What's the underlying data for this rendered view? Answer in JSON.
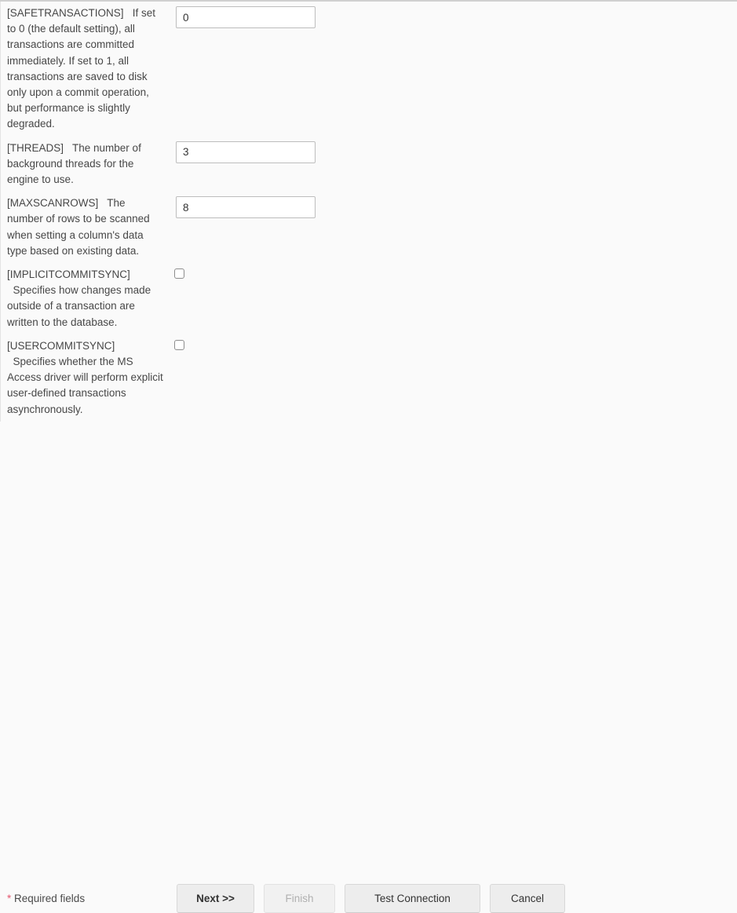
{
  "window": {
    "background_color": "#fafafa",
    "text_color": "#474747"
  },
  "form": {
    "rows": [
      {
        "label": "[SAFETRANSACTIONS]   If set to 0 (the default setting), all transactions are committed immediately. If set to 1, all transactions are saved to disk only upon a commit operation, but performance is slightly degraded.",
        "control": "text",
        "name": "safetransactions",
        "value": "0",
        "placeholder": ""
      },
      {
        "label": "[THREADS]   The number of background threads for the engine to use.",
        "control": "text",
        "name": "threads",
        "value": "3",
        "placeholder": ""
      },
      {
        "label": "[MAXSCANROWS]   The number of rows to be scanned when setting a column's data type based on existing data.",
        "control": "text",
        "name": "maxscanrows",
        "value": "8",
        "placeholder": ""
      },
      {
        "label": "[IMPLICITCOMMITSYNC]\n  Specifies how changes made outside of a transaction are written to the database.",
        "control": "checkbox",
        "name": "implicitcommitsync",
        "checked": false
      },
      {
        "label": "[USERCOMMITSYNC]\n  Specifies whether the MS Access driver will perform explicit user-defined transactions asynchronously.",
        "control": "checkbox",
        "name": "usercommitsync",
        "checked": false
      }
    ]
  },
  "footer": {
    "required_star": "*",
    "required_text": " Required fields",
    "required_star_color": "#e4566e",
    "buttons": [
      {
        "label": "Next >>",
        "name": "next",
        "disabled": false,
        "primary": true
      },
      {
        "label": "Finish",
        "name": "finish",
        "disabled": true,
        "primary": false
      },
      {
        "label": "Test Connection",
        "name": "test-connection",
        "disabled": false,
        "primary": false
      },
      {
        "label": "Cancel",
        "name": "cancel",
        "disabled": false,
        "primary": false
      }
    ]
  }
}
